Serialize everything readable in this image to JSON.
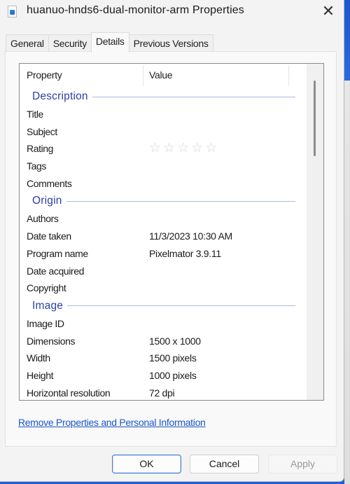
{
  "window": {
    "title": "huanuo-hnds6-dual-monitor-arm Properties",
    "icon": "image-file-icon",
    "close_glyph": "✕"
  },
  "tabs": [
    {
      "label": "General",
      "active": false
    },
    {
      "label": "Security",
      "active": false
    },
    {
      "label": "Details",
      "active": true
    },
    {
      "label": "Previous Versions",
      "active": false
    }
  ],
  "list": {
    "columns": {
      "property": "Property",
      "value": "Value"
    },
    "groups": [
      {
        "label": "Description",
        "rows": [
          {
            "property": "Title",
            "value": ""
          },
          {
            "property": "Subject",
            "value": ""
          },
          {
            "property": "Rating",
            "value": "",
            "rating": {
              "value": 0,
              "max": 5,
              "glyph": "☆"
            }
          },
          {
            "property": "Tags",
            "value": ""
          },
          {
            "property": "Comments",
            "value": ""
          }
        ]
      },
      {
        "label": "Origin",
        "rows": [
          {
            "property": "Authors",
            "value": ""
          },
          {
            "property": "Date taken",
            "value": "11/3/2023 10:30 AM"
          },
          {
            "property": "Program name",
            "value": "Pixelmator 3.9.11"
          },
          {
            "property": "Date acquired",
            "value": ""
          },
          {
            "property": "Copyright",
            "value": ""
          }
        ]
      },
      {
        "label": "Image",
        "rows": [
          {
            "property": "Image ID",
            "value": ""
          },
          {
            "property": "Dimensions",
            "value": "1500 x 1000"
          },
          {
            "property": "Width",
            "value": "1500 pixels"
          },
          {
            "property": "Height",
            "value": "1000 pixels"
          },
          {
            "property": "Horizontal resolution",
            "value": "72 dpi"
          }
        ]
      }
    ]
  },
  "link": {
    "label": "Remove Properties and Personal Information"
  },
  "buttons": {
    "ok": "OK",
    "cancel": "Cancel",
    "apply": "Apply"
  },
  "colors": {
    "group_header": "#2c3fa6",
    "link": "#1a56c8",
    "accent": "#3b78d8"
  }
}
